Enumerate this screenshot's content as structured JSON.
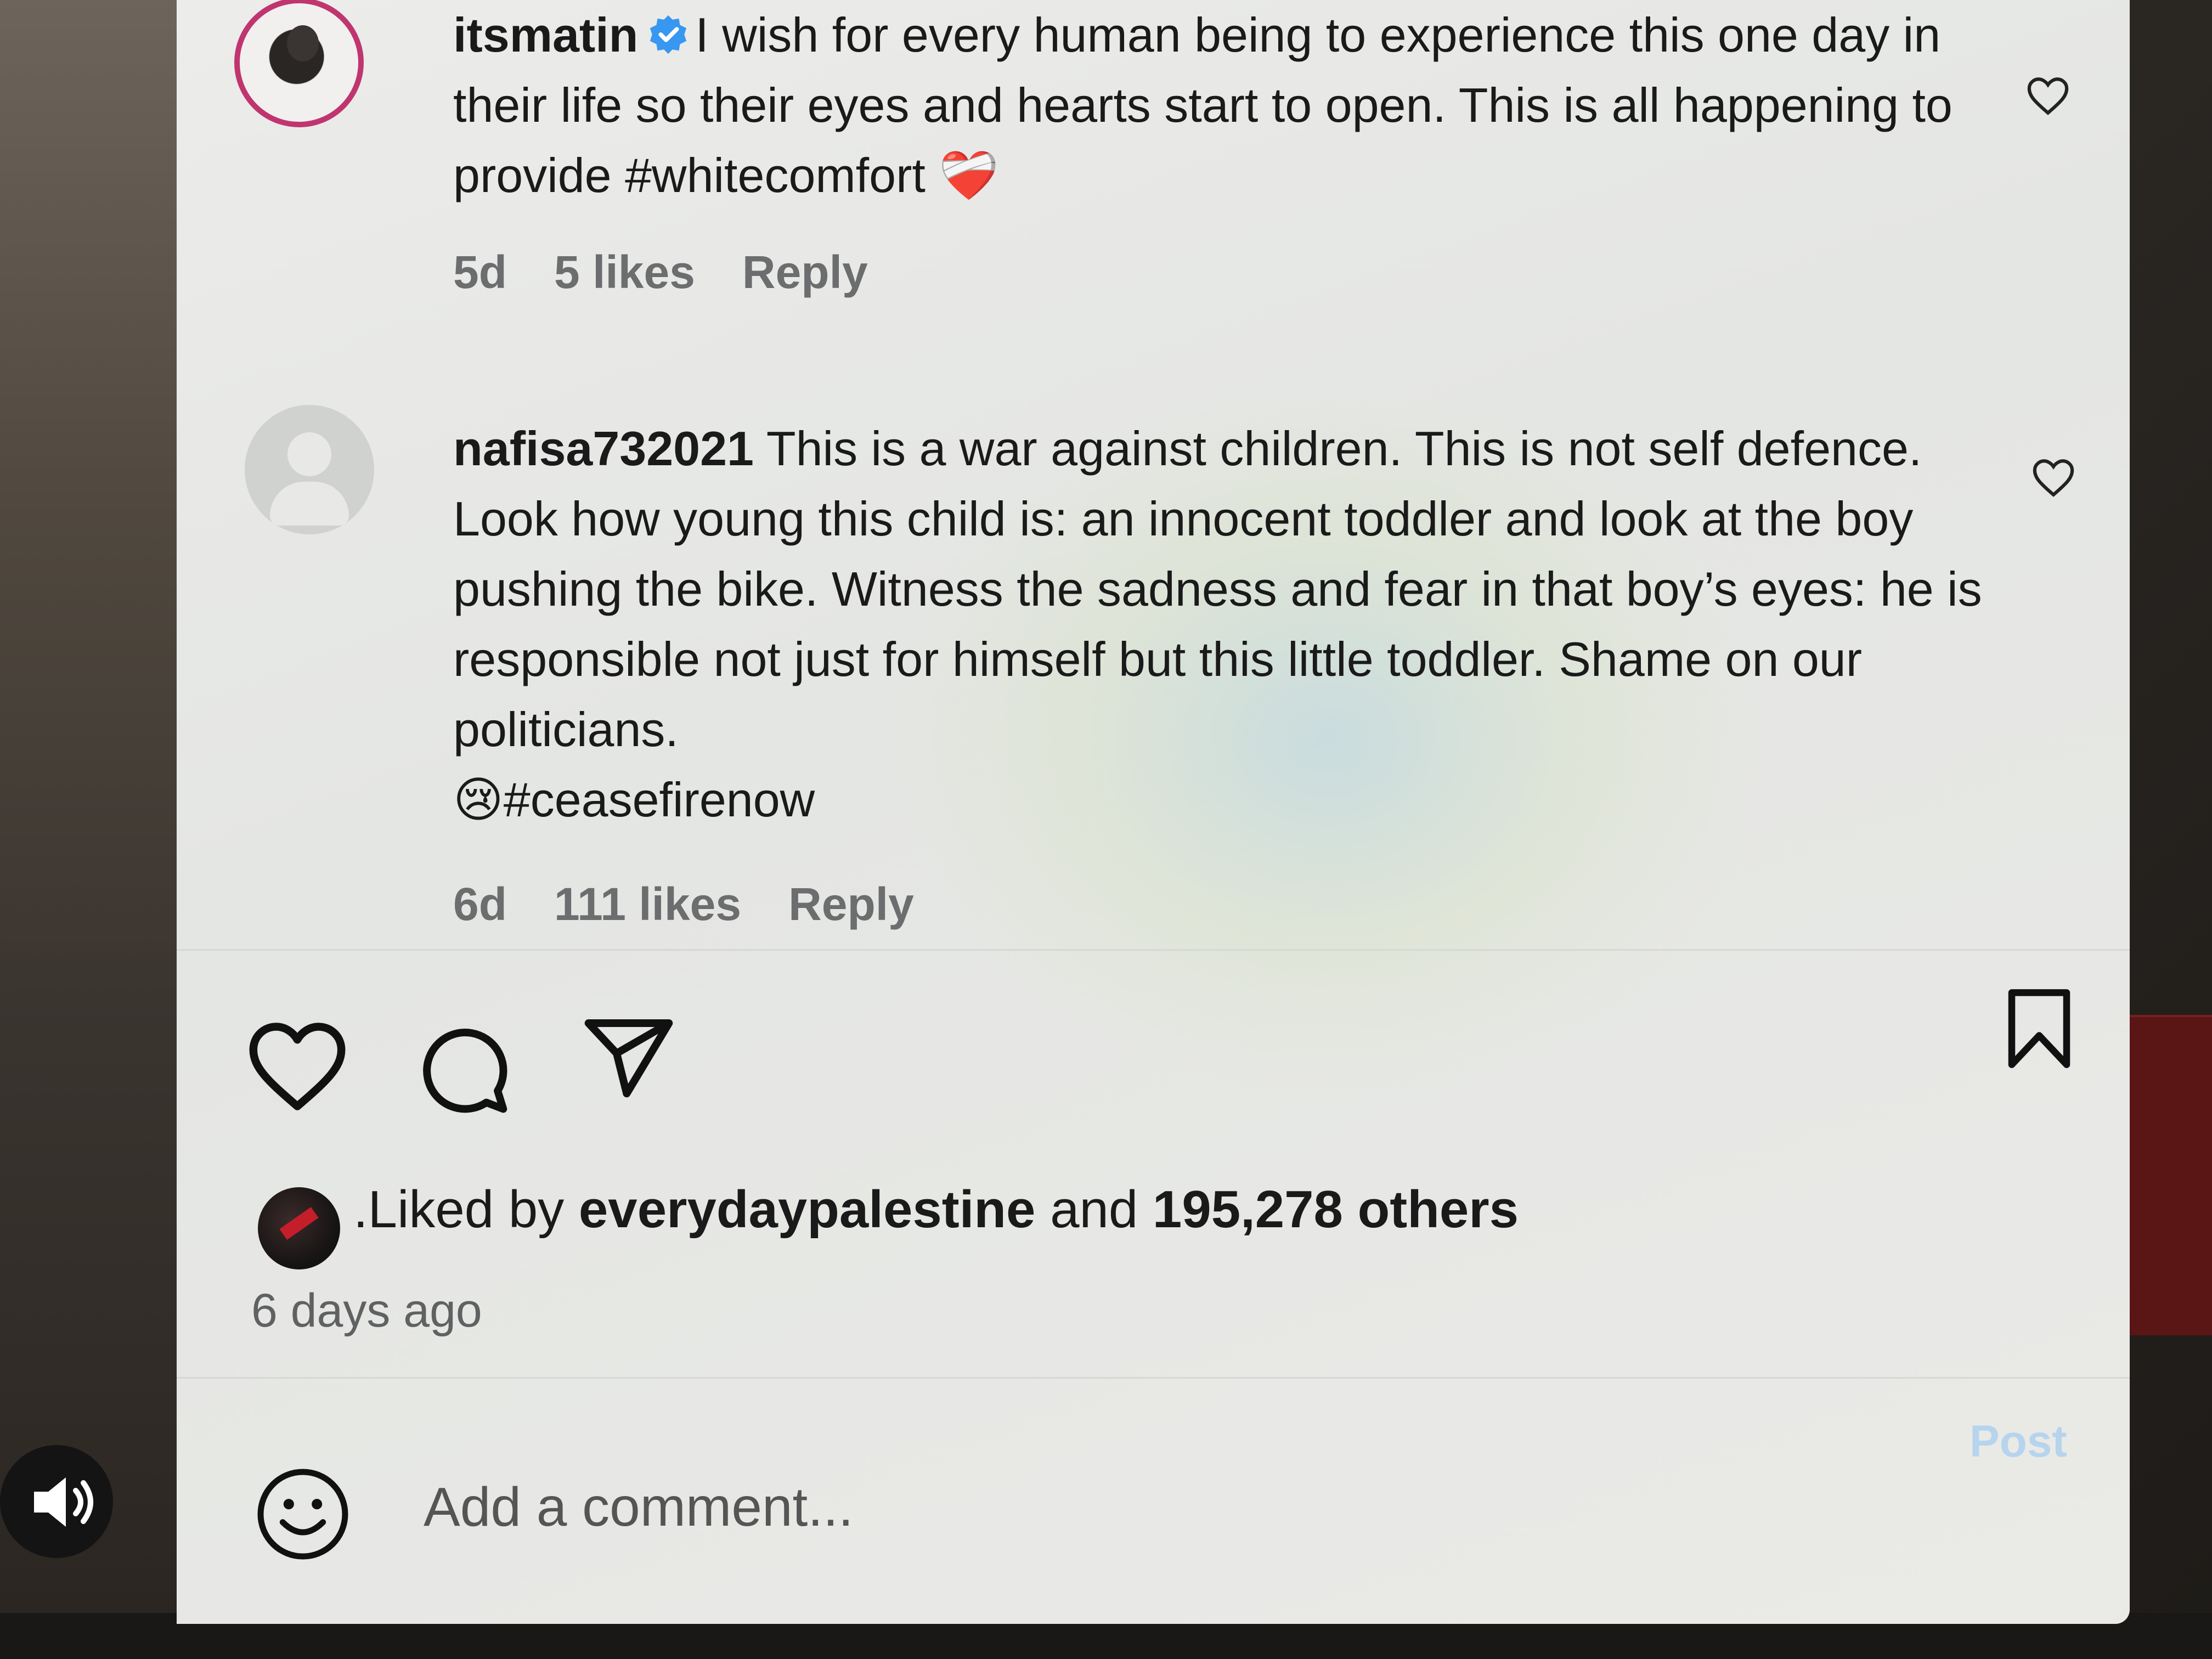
{
  "comments": [
    {
      "username": "itsmatin",
      "verified": true,
      "text": "I wish for every human being to experience this one day in their life so their eyes and hearts start to open. This is all happening to provide #whitecomfort",
      "emoji": "❤️‍🩹",
      "age": "5d",
      "likes": "5 likes",
      "reply_label": "Reply"
    },
    {
      "username": "nafisa732021",
      "verified": false,
      "text": "This is a war against children. This is not self defence. Look how young this child is: an innocent toddler and look at the boy pushing the bike. Witness the sadness and fear in that boy’s eyes: he is responsible not just for himself but this little toddler. Shame on our politicians.",
      "emoji": "😢",
      "hashtag": "#ceasefirenow",
      "age": "6d",
      "likes": "111 likes",
      "reply_label": "Reply"
    }
  ],
  "actions": {
    "like_icon": "heart-icon",
    "comment_icon": "comment-icon",
    "share_icon": "share-icon",
    "save_icon": "bookmark-icon"
  },
  "likes_summary": {
    "prefix": ".Liked by",
    "user": "everydaypalestine",
    "connector": "and",
    "count": "195,278 others"
  },
  "posted_time": "6 days ago",
  "comment_box": {
    "placeholder": "Add a comment...",
    "post_label": "Post"
  },
  "colors": {
    "story_ring": "#c0356f",
    "verified": "#3897f0",
    "post_disabled": "#b7d4ee",
    "meta_text": "#6b6d6e"
  }
}
